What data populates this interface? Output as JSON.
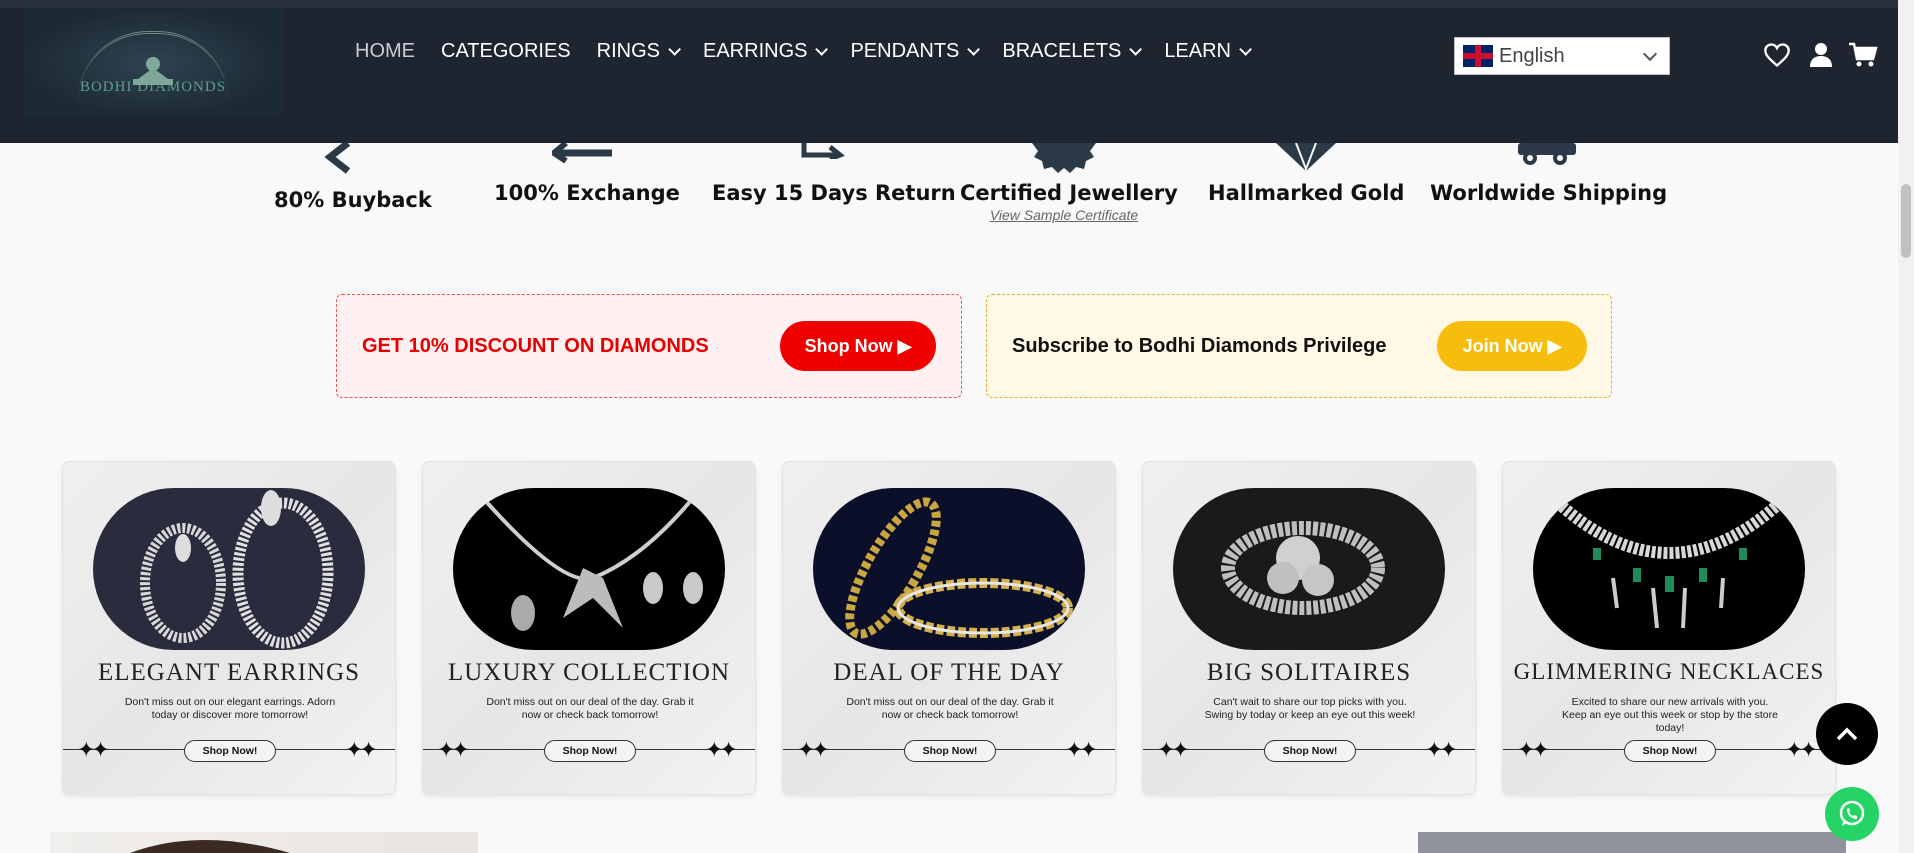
{
  "header": {
    "logo_alt": "BODHI DIAMONDS",
    "nav": [
      {
        "label": "HOME",
        "dropdown": false,
        "active": true
      },
      {
        "label": "CATEGORIES",
        "dropdown": false,
        "active": false
      },
      {
        "label": "RINGS",
        "dropdown": true,
        "active": false
      },
      {
        "label": "EARRINGS",
        "dropdown": true,
        "active": false
      },
      {
        "label": "PENDANTS",
        "dropdown": true,
        "active": false
      },
      {
        "label": "BRACELETS",
        "dropdown": true,
        "active": false
      },
      {
        "label": "LEARN",
        "dropdown": true,
        "active": false
      }
    ],
    "language": "English",
    "icons": [
      "heart-icon",
      "user-icon",
      "cart-icon"
    ]
  },
  "features": [
    {
      "label": "80% Buyback",
      "icon": "buyback-icon"
    },
    {
      "label": "100% Exchange",
      "icon": "exchange-icon"
    },
    {
      "label": "Easy 15 Days Return",
      "icon": "return-icon"
    },
    {
      "label": "Certified Jewellery",
      "icon": "certificate-icon",
      "sub": "View Sample Certificate"
    },
    {
      "label": "Hallmarked Gold",
      "icon": "diamond-icon"
    },
    {
      "label": "Worldwide Shipping",
      "icon": "truck-icon"
    }
  ],
  "promos": {
    "discount": {
      "text": "GET 10% DISCOUNT ON DIAMONDS",
      "button": "Shop Now ▶",
      "color": "#e60000"
    },
    "subscribe": {
      "text": "Subscribe to Bodhi Diamonds Privilege",
      "button": "Join Now ▶",
      "color": "#f5b800"
    }
  },
  "cards": [
    {
      "title": "ELEGANT EARRINGS",
      "desc": "Don't miss out on our elegant earrings. Adorn today or discover more tomorrow!",
      "button": "Shop Now!"
    },
    {
      "title": "LUXURY COLLECTION",
      "desc": "Don't miss out on our deal of the day. Grab it now or check back tomorrow!",
      "button": "Shop Now!"
    },
    {
      "title": "DEAL OF THE DAY",
      "desc": "Don't miss out on our deal of the day. Grab it now or check back tomorrow!",
      "button": "Shop Now!"
    },
    {
      "title": "BIG SOLITAIRES",
      "desc": "Can't wait to share our top picks with you. Swing by today or keep an eye out this week!",
      "button": "Shop Now!"
    },
    {
      "title": "GLIMMERING NECKLACES",
      "desc": "Excited to share our new arrivals with you. Keep an eye out this week or stop by the store today!",
      "button": "Shop Now!"
    }
  ],
  "colors": {
    "header_bg": "#1e2530",
    "page_bg": "#f9f9f9",
    "whatsapp": "#25d366"
  }
}
